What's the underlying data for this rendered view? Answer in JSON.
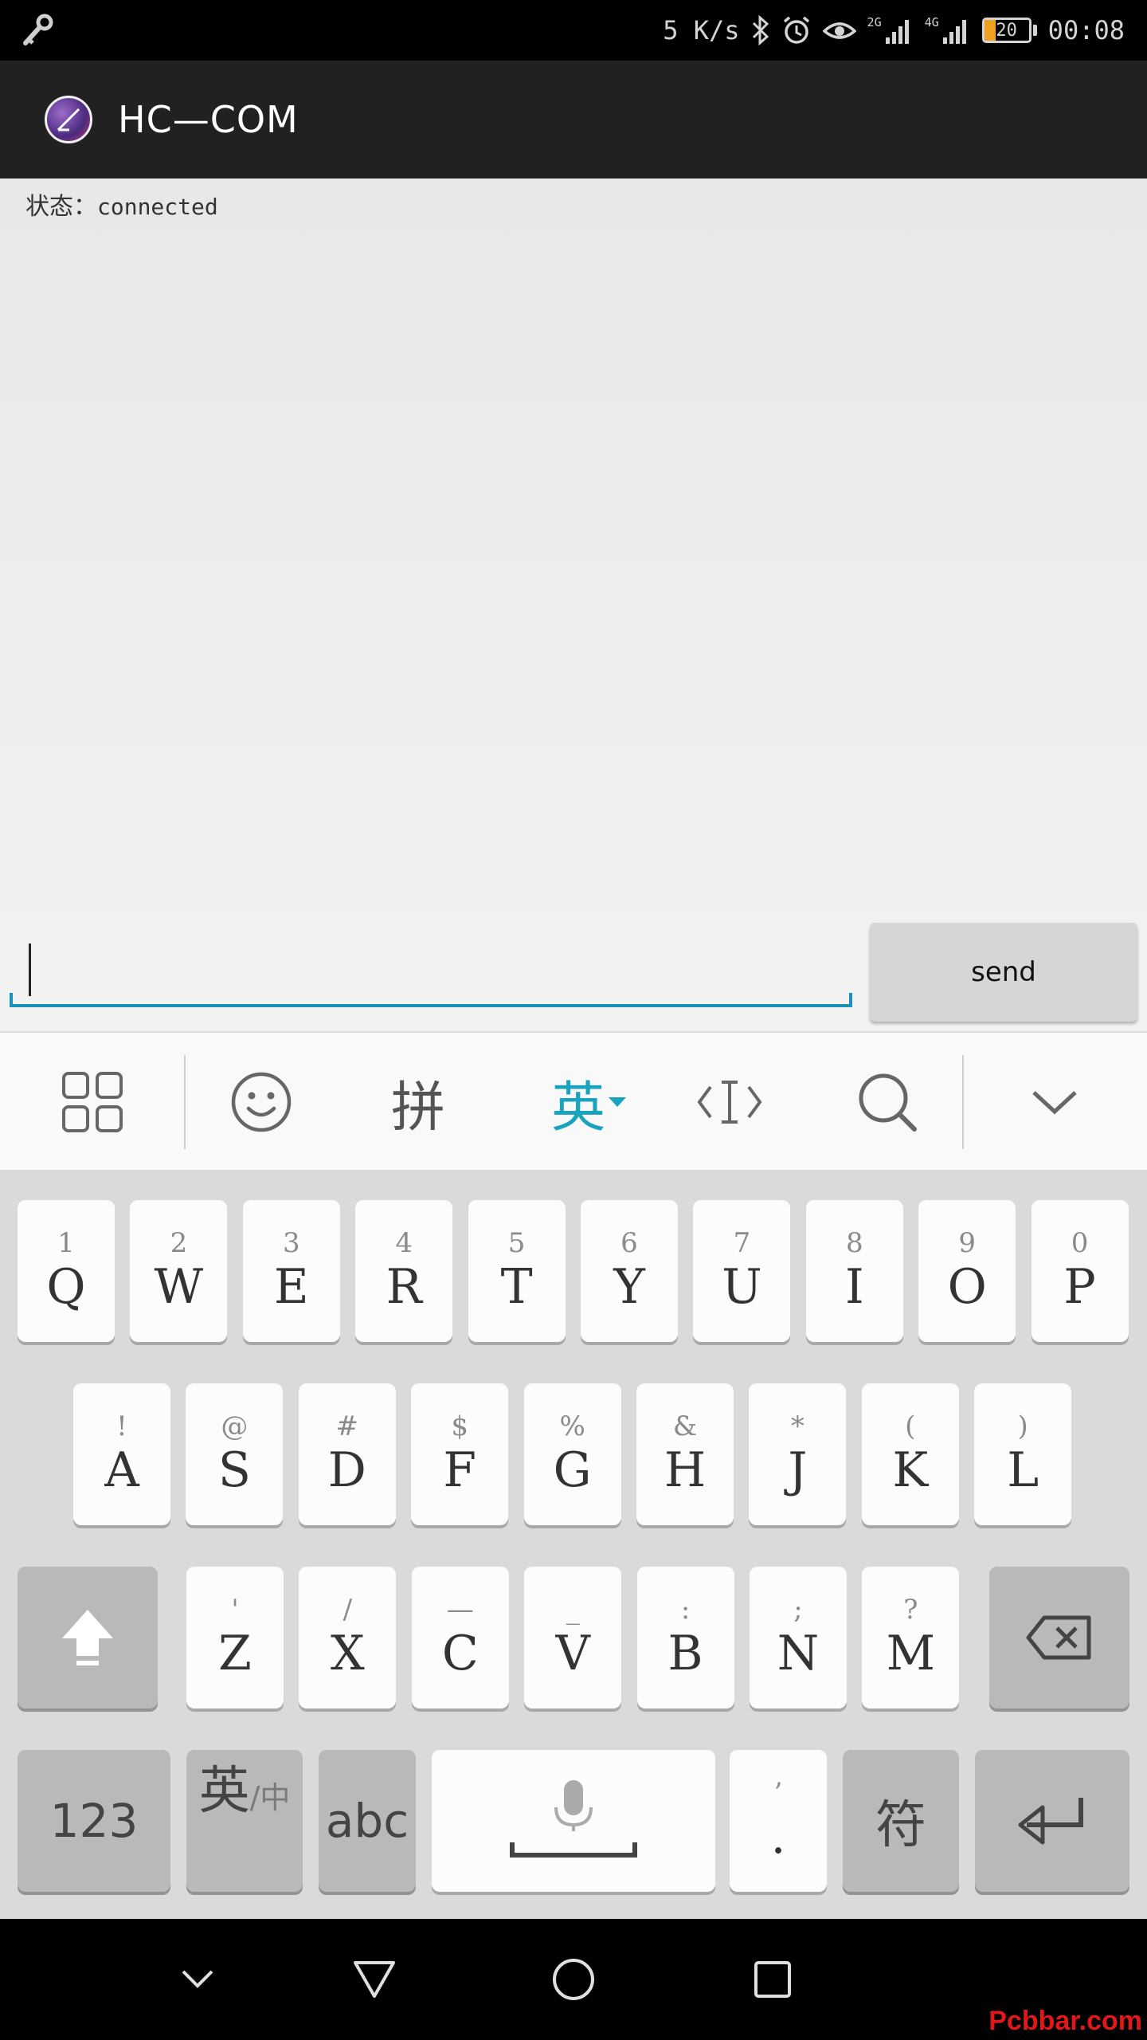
{
  "status_bar": {
    "speed": "5 K/s",
    "net_2g": "2G",
    "net_4g": "4G",
    "battery": "20",
    "time": "00:08"
  },
  "app_bar": {
    "title": "HC—COM"
  },
  "content": {
    "status_label": "状态：",
    "status_value": "connected",
    "input_value": "",
    "send_label": "send"
  },
  "toolbar": {
    "pinyin": "拼",
    "english": "英",
    "cursor_tool": "‹I›"
  },
  "keyboard": {
    "row1": [
      {
        "sec": "1",
        "main": "Q"
      },
      {
        "sec": "2",
        "main": "W"
      },
      {
        "sec": "3",
        "main": "E"
      },
      {
        "sec": "4",
        "main": "R"
      },
      {
        "sec": "5",
        "main": "T"
      },
      {
        "sec": "6",
        "main": "Y"
      },
      {
        "sec": "7",
        "main": "U"
      },
      {
        "sec": "8",
        "main": "I"
      },
      {
        "sec": "9",
        "main": "O"
      },
      {
        "sec": "0",
        "main": "P"
      }
    ],
    "row2": [
      {
        "sec": "!",
        "main": "A"
      },
      {
        "sec": "@",
        "main": "S"
      },
      {
        "sec": "#",
        "main": "D"
      },
      {
        "sec": "$",
        "main": "F"
      },
      {
        "sec": "%",
        "main": "G"
      },
      {
        "sec": "&",
        "main": "H"
      },
      {
        "sec": "*",
        "main": "J"
      },
      {
        "sec": "(",
        "main": "K"
      },
      {
        "sec": ")",
        "main": "L"
      }
    ],
    "row3": [
      {
        "sec": "'",
        "main": "Z"
      },
      {
        "sec": "/",
        "main": "X"
      },
      {
        "sec": "—",
        "main": "C"
      },
      {
        "sec": "_",
        "main": "V"
      },
      {
        "sec": ":",
        "main": "B"
      },
      {
        "sec": ";",
        "main": "N"
      },
      {
        "sec": "?",
        "main": "M"
      }
    ],
    "num_label": "123",
    "lang_main": "英",
    "lang_sub": "/中",
    "abc_label": "abc",
    "punct_sec": "’",
    "punct_main": ".",
    "symbol_label": "符"
  },
  "watermark": "Pcbbar.com"
}
